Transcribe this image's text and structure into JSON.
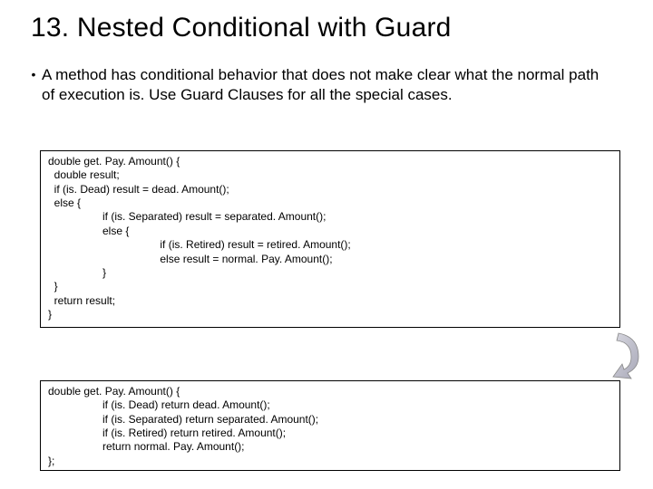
{
  "title": "13.  Nested Conditional with Guard",
  "bullet": "A method has conditional behavior that does not make clear what the normal path of execution is.  Use Guard Clauses for all the special cases.",
  "code1": "double get. Pay. Amount() {\n  double result;\n  if (is. Dead) result = dead. Amount();\n  else {\n                  if (is. Separated) result = separated. Amount();\n                  else {\n                                     if (is. Retired) result = retired. Amount();\n                                     else result = normal. Pay. Amount();\n                  }\n  }\n  return result;\n}",
  "code2": "double get. Pay. Amount() {\n                  if (is. Dead) return dead. Amount();\n                  if (is. Separated) return separated. Amount();\n                  if (is. Retired) return retired. Amount();\n                  return normal. Pay. Amount();\n};"
}
